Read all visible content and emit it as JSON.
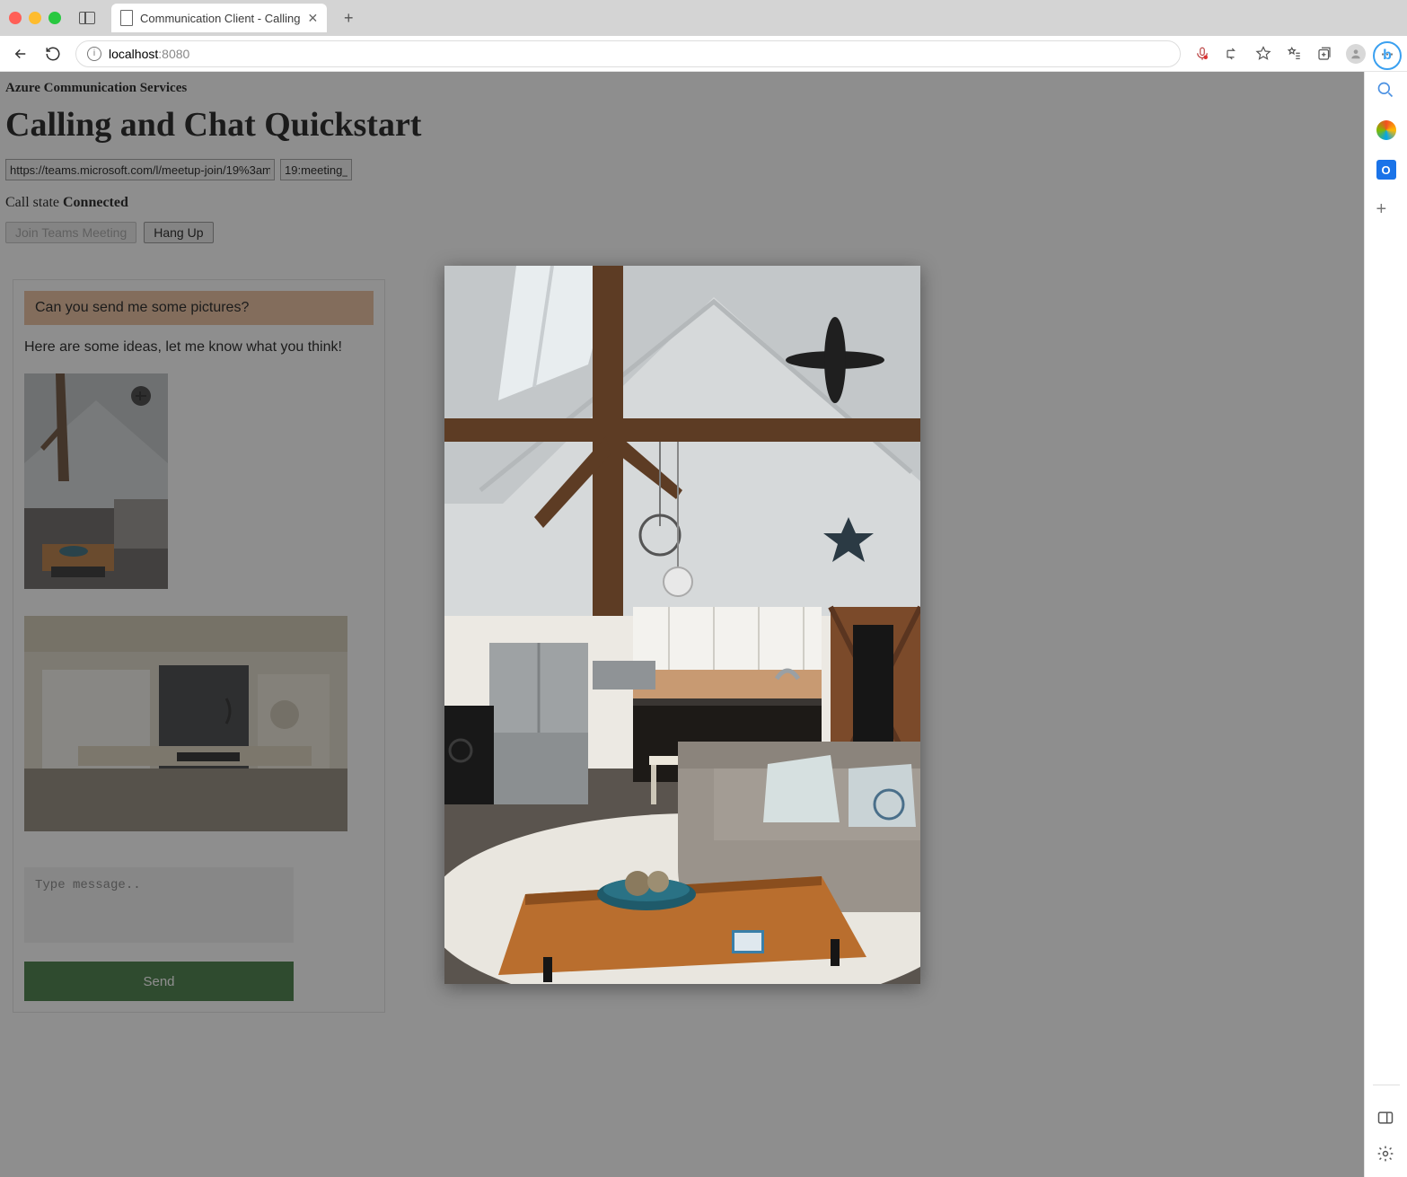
{
  "browser": {
    "tab_title": "Communication Client - Calling",
    "url_host": "localhost",
    "url_port": ":8080"
  },
  "page": {
    "subtitle": "Azure Communication Services",
    "heading": "Calling and Chat Quickstart",
    "meeting_link_value": "https://teams.microsoft.com/l/meetup-join/19%3am",
    "thread_id_value": "19:meeting_",
    "call_state_label": "Call state ",
    "call_state_value": "Connected",
    "join_button": "Join Teams Meeting",
    "hangup_button": "Hang Up"
  },
  "chat": {
    "incoming_message": "Can you send me some pictures?",
    "outgoing_message": "Here are some ideas, let me know what you think!",
    "compose_placeholder": "Type message..",
    "send_label": "Send"
  },
  "sidebar": {
    "outlook_letter": "O"
  }
}
